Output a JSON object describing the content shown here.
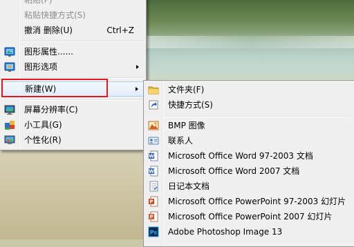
{
  "context_menu": {
    "items": [
      {
        "label": "粘贴(P)",
        "disabled": true
      },
      {
        "label": "粘贴快捷方式(S)",
        "disabled": true
      },
      {
        "label": "撤消 删除(U)",
        "shortcut": "Ctrl+Z"
      },
      {
        "label": "图形属性......",
        "icon": "graphics-properties-icon"
      },
      {
        "label": "图形选项",
        "icon": "graphics-options-icon",
        "submenu": true
      },
      {
        "label": "新建(W)",
        "submenu": true,
        "active": true
      },
      {
        "label": "屏幕分辨率(C)",
        "icon": "screen-resolution-icon"
      },
      {
        "label": "小工具(G)",
        "icon": "gadgets-icon"
      },
      {
        "label": "个性化(R)",
        "icon": "personalize-icon"
      }
    ]
  },
  "new_submenu": {
    "items": [
      {
        "label": "文件夹(F)",
        "icon": "folder-icon"
      },
      {
        "label": "快捷方式(S)",
        "icon": "shortcut-icon"
      },
      {
        "label": "BMP 图像",
        "icon": "bmp-image-icon"
      },
      {
        "label": "联系人",
        "icon": "contact-icon"
      },
      {
        "label": "Microsoft Office Word 97-2003 文档",
        "icon": "word-97-icon"
      },
      {
        "label": "Microsoft Office Word 2007 文档",
        "icon": "word-2007-icon"
      },
      {
        "label": "日记本文档",
        "icon": "journal-document-icon"
      },
      {
        "label": "Microsoft Office PowerPoint 97-2003 幻灯片",
        "icon": "powerpoint-97-icon"
      },
      {
        "label": "Microsoft Office PowerPoint 2007 幻灯片",
        "icon": "powerpoint-2007-icon"
      },
      {
        "label": "Adobe Photoshop Image 13",
        "icon": "photoshop-icon"
      }
    ]
  },
  "colors": {
    "highlight_box": "#e8141b",
    "menu_background": "#f0f0f0",
    "hover_border": "#aecff7"
  }
}
